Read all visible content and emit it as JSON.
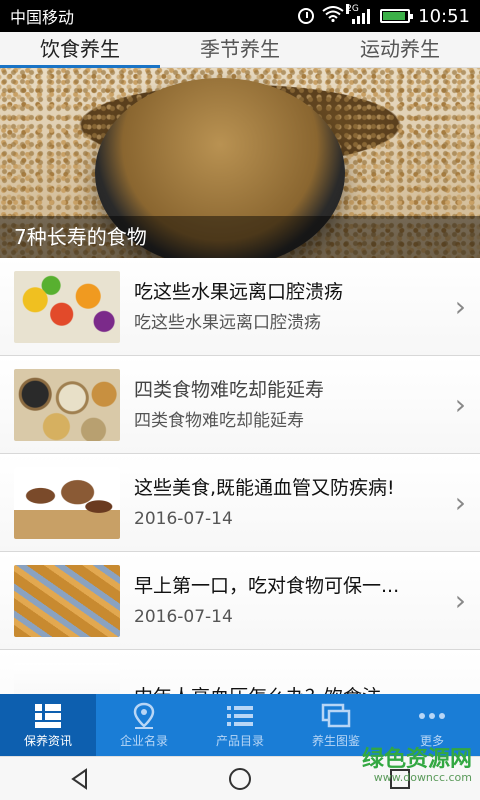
{
  "statusbar": {
    "carrier": "中国移动",
    "network": "2G",
    "time": "10:51"
  },
  "tabs": [
    {
      "label": "饮食养生",
      "active": true
    },
    {
      "label": "季节养生",
      "active": false
    },
    {
      "label": "运动养生",
      "active": false
    }
  ],
  "banner": {
    "caption": "7种长寿的食物"
  },
  "articles": [
    {
      "title": "吃这些水果远离口腔溃疡",
      "subtitle": "吃这些水果远离口腔溃疡",
      "thumb": "fruits"
    },
    {
      "title": "四类食物难吃却能延寿",
      "subtitle": "四类食物难吃却能延寿",
      "thumb": "grains"
    },
    {
      "title": "这些美食,既能通血管又防疾病!",
      "subtitle": "2016-07-14",
      "thumb": "mushrooms"
    },
    {
      "title": "早上第一口，吃对食物可保一...",
      "subtitle": "2016-07-14",
      "thumb": "fried-dough"
    },
    {
      "title": "中年人高血压怎么办？饮食注...",
      "subtitle": "",
      "thumb": "blood-pressure"
    }
  ],
  "bottom_nav": [
    {
      "label": "保养资讯",
      "icon": "grid-list-icon",
      "active": true
    },
    {
      "label": "企业名录",
      "icon": "map-pin-icon",
      "active": false
    },
    {
      "label": "产品目录",
      "icon": "bullet-list-icon",
      "active": false
    },
    {
      "label": "养生图鉴",
      "icon": "gallery-icon",
      "active": false
    },
    {
      "label": "更多",
      "icon": "more-dots-icon",
      "active": false
    }
  ],
  "watermark": {
    "title": "绿色资源网",
    "url": "www.downcc.com"
  },
  "colors": {
    "nav_bg": "#1a7dd6",
    "nav_active_bg": "#0d5faf",
    "tab_indicator": "#1a74c6"
  }
}
